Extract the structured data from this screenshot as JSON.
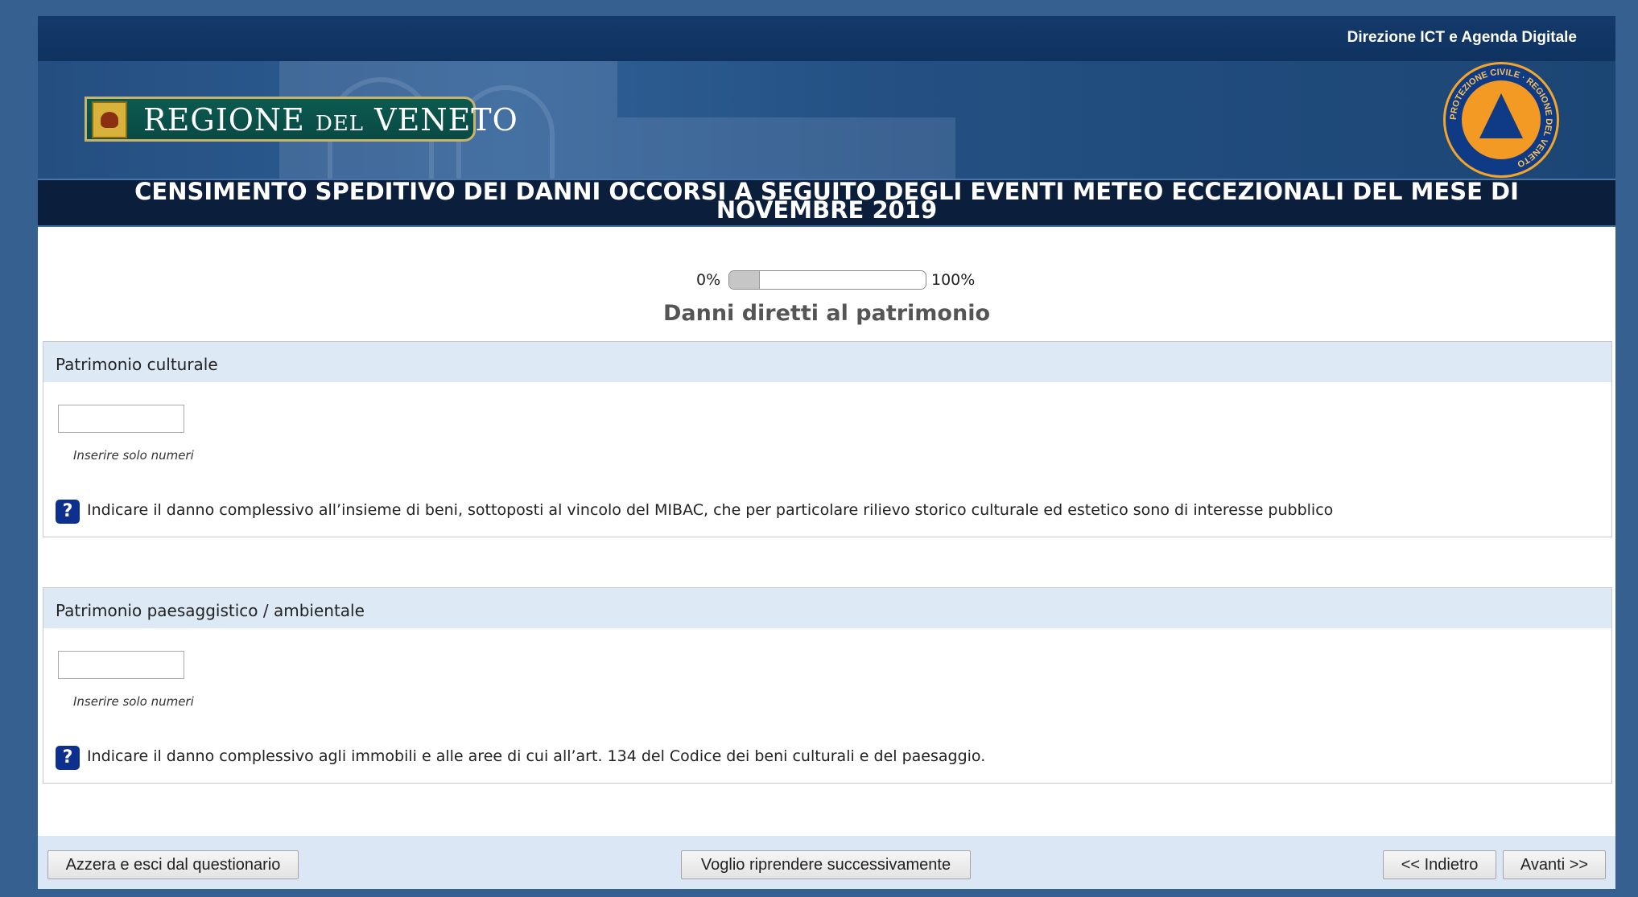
{
  "header": {
    "org_link": "Direzione ICT e Agenda Digitale",
    "region_logo_text_1": "REGIONE",
    "region_logo_text_2": "DEL",
    "region_logo_text_3": "VENETO",
    "title": "CENSIMENTO SPEDITIVO DEI DANNI OCCORSI A SEGUITO DEGLI EVENTI METEO ECCEZIONALI DEL MESE DI NOVEMBRE 2019",
    "protezione_civile_logo_text": "PROTEZIONE CIVILE · REGIONE DEL VENETO"
  },
  "progress": {
    "start_label": "0%",
    "end_label": "100%",
    "value": 0.15
  },
  "page": {
    "heading": "Danni diretti al patrimonio"
  },
  "questions": [
    {
      "label": "Patrimonio culturale",
      "value": "",
      "hint": "Inserire solo numeri",
      "help": "Indicare il danno complessivo all’insieme di beni, sottoposti al vincolo del MIBAC, che per particolare rilievo storico culturale ed estetico sono di interesse pubblico"
    },
    {
      "label": "Patrimonio paesaggistico / ambientale",
      "value": "",
      "hint": "Inserire solo numeri",
      "help": "Indicare il danno complessivo agli immobili e alle aree di cui all’art. 134 del Codice dei beni culturali e del paesaggio."
    }
  ],
  "footer": {
    "reset_button": "Azzera e esci dal questionario",
    "resume_button": "Voglio riprendere successivamente",
    "back_button": "<< Indietro",
    "next_button": "Avanti >>"
  },
  "help_icon_glyph": "?",
  "colors": {
    "background": "#35608f",
    "header_bar": "#143a6b",
    "title_band": "#0b1e3b",
    "question_header": "#dde9f5",
    "footer_bar": "#dbe7f4",
    "help_icon": "#0d2f8e"
  }
}
